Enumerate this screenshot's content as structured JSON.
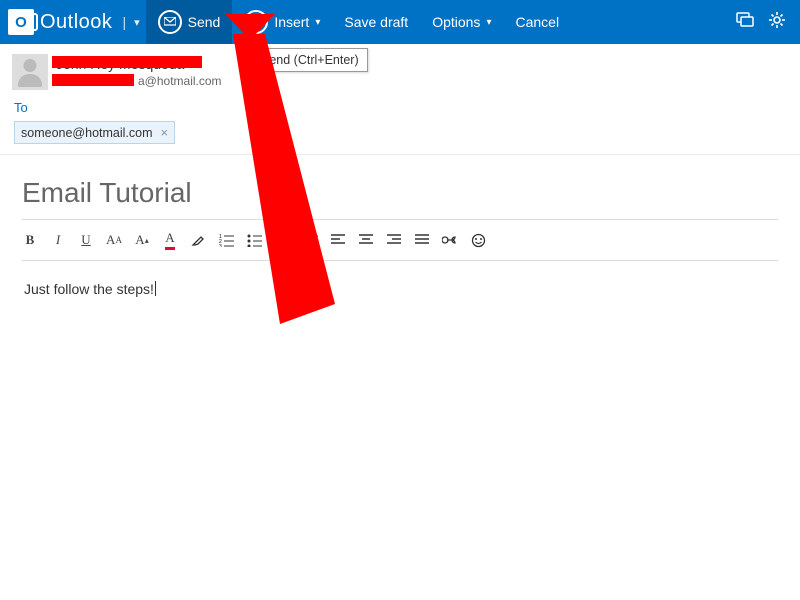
{
  "brand": {
    "logo_letter": "O",
    "name": "Outlook"
  },
  "toolbar": {
    "send": "Send",
    "insert": "Insert",
    "save_draft": "Save draft",
    "options": "Options",
    "cancel": "Cancel"
  },
  "tooltip": "Send (Ctrl+Enter)",
  "sender": {
    "name": "John Rey Mosqueda",
    "email_visible_suffix": "a@hotmail.com"
  },
  "to": {
    "label": "To",
    "recipients": [
      {
        "address": "someone@hotmail.com"
      }
    ]
  },
  "subject": "Email Tutorial",
  "body": "Just follow the steps!",
  "colors": {
    "primary": "#0072C6",
    "primary_dark": "#005A9E",
    "redaction": "#ff0000"
  }
}
